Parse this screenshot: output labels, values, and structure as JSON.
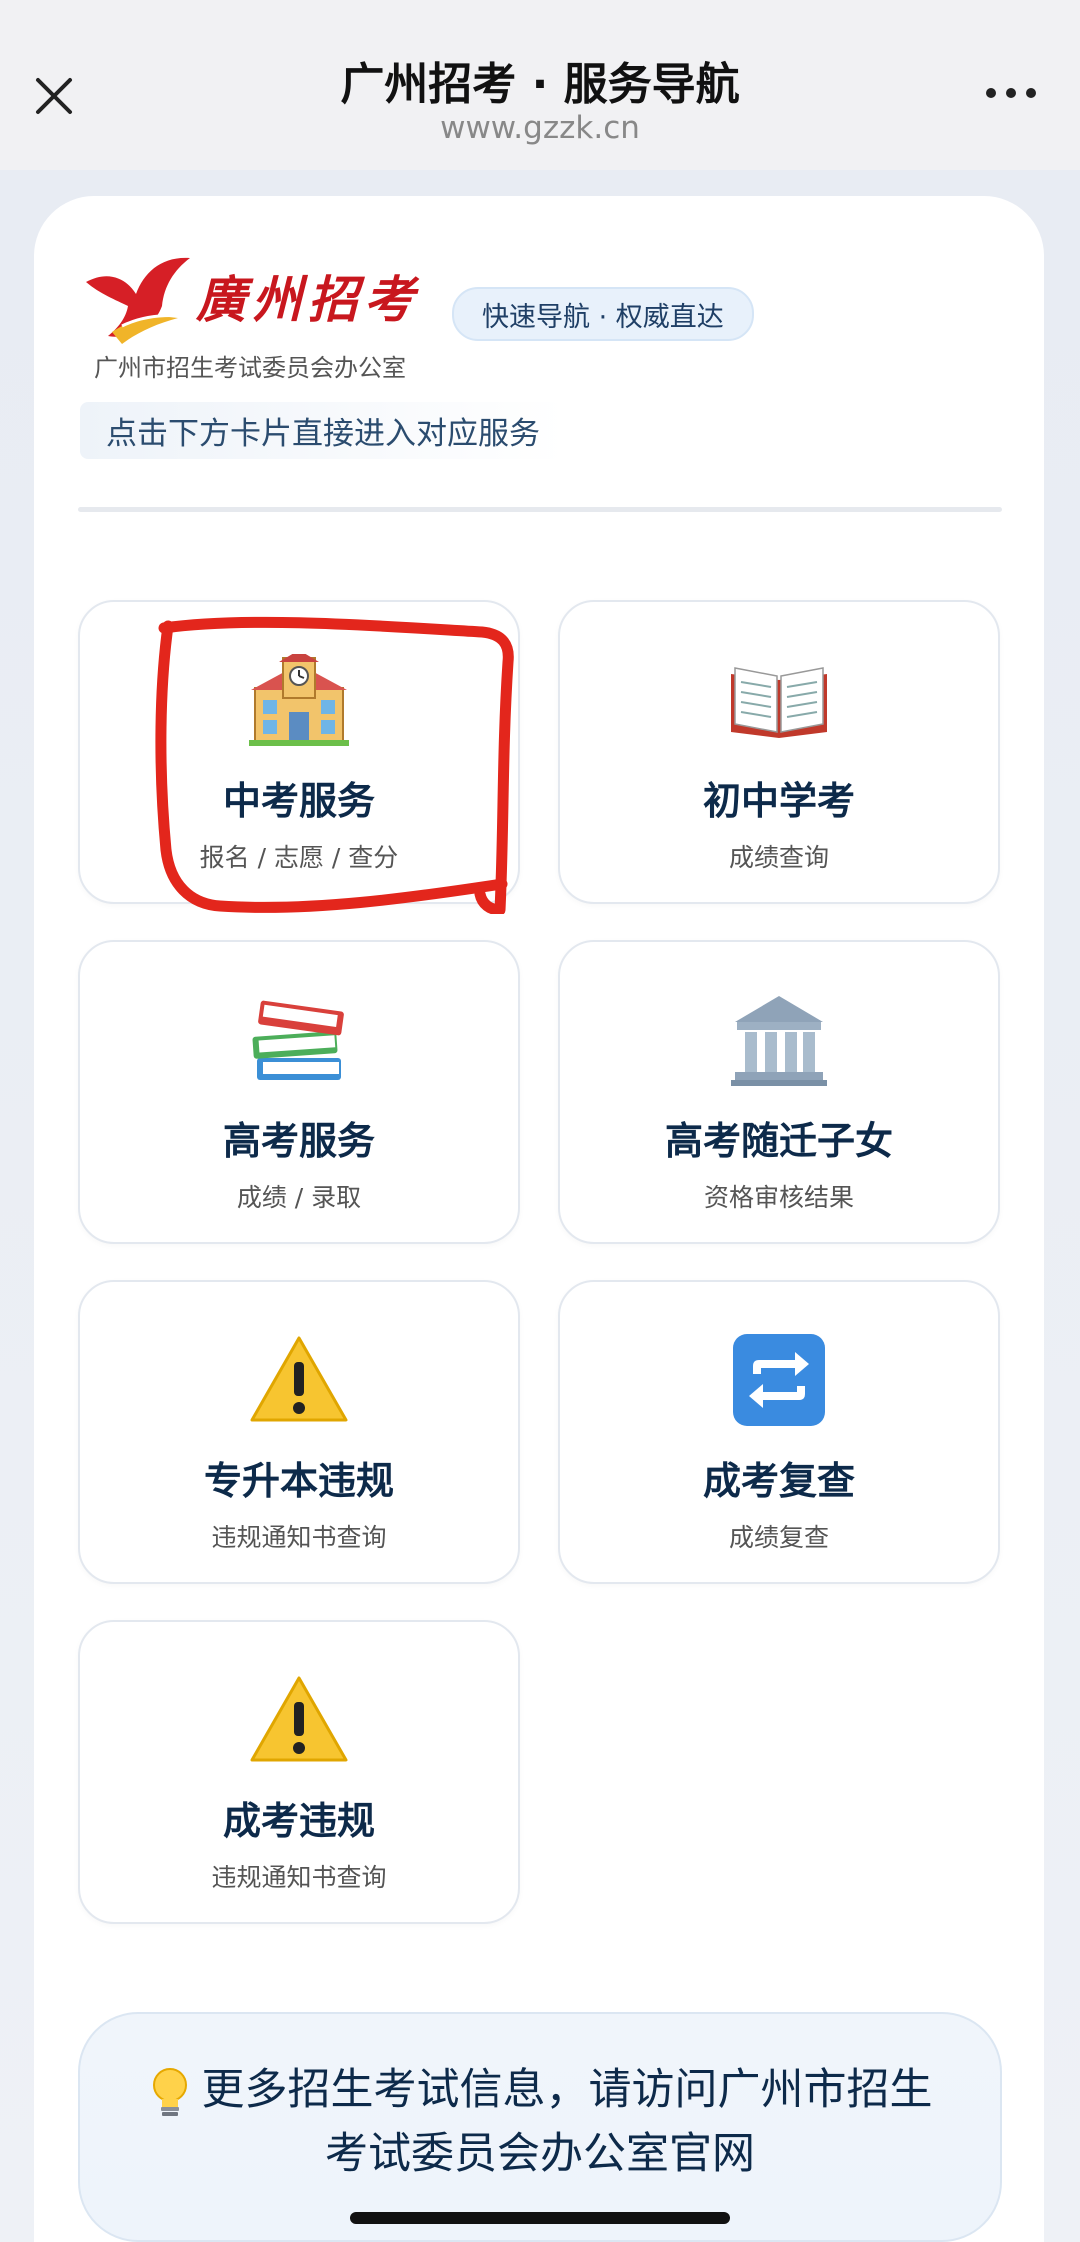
{
  "header": {
    "title": "广州招考 · 服务导航",
    "url": "www.gzzk.cn"
  },
  "brand": {
    "name": "廣州招考",
    "org": "广州市招生考试委员会办公室",
    "color": "#c8171e"
  },
  "badge": "快速导航 · 权威直达",
  "hint": "点击下方卡片直接进入对应服务",
  "cards": [
    {
      "title": "中考服务",
      "desc": "报名 / 志愿 / 查分",
      "icon": "school-icon"
    },
    {
      "title": "初中学考",
      "desc": "成绩查询",
      "icon": "open-book-icon"
    },
    {
      "title": "高考服务",
      "desc": "成绩 / 录取",
      "icon": "books-icon"
    },
    {
      "title": "高考随迁子女",
      "desc": "资格审核结果",
      "icon": "classical-building-icon"
    },
    {
      "title": "专升本违规",
      "desc": "违规通知书查询",
      "icon": "warning-icon"
    },
    {
      "title": "成考复查",
      "desc": "成绩复查",
      "icon": "repeat-arrows-icon"
    },
    {
      "title": "成考违规",
      "desc": "违规通知书查询",
      "icon": "warning-icon"
    }
  ],
  "footer": {
    "text": "更多招生考试信息，请访问广州市招生考试委员会办公室官网",
    "icon": "light-bulb-icon"
  },
  "colors": {
    "title_text": "#0d2a4a",
    "highlight_stroke": "#e3261c",
    "badge_bg": "#e8f1fb"
  }
}
